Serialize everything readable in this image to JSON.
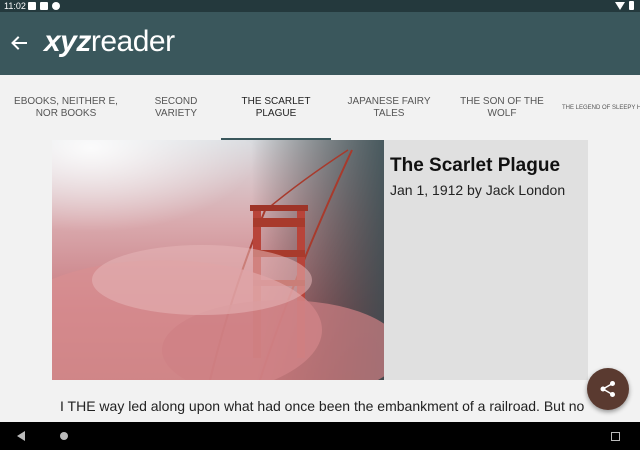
{
  "status_bar": {
    "time": "11:02"
  },
  "app_bar": {
    "logo_bold": "xyz",
    "logo_rest": "reader"
  },
  "tabs": [
    {
      "label": "EBOOKS, NEITHER E, NOR BOOKS"
    },
    {
      "label": "SECOND VARIETY"
    },
    {
      "label": "THE SCARLET PLAGUE"
    },
    {
      "label": "JAPANESE FAIRY TALES"
    },
    {
      "label": "THE SON OF THE WOLF"
    },
    {
      "label": "THE LEGEND OF SLEEPY HO"
    }
  ],
  "active_tab": 2,
  "article": {
    "title": "The Scarlet Plague",
    "byline": "Jan 1, 1912 by Jack London",
    "body_start": "I THE way led along upon what had once been the embankment of a railroad. But no"
  },
  "colors": {
    "toolbar": "#3a575c",
    "status_bar": "#24393d",
    "fab": "#5a3a30",
    "meta_panel": "#e0e0e0"
  },
  "icons": {
    "back": "arrow-left-icon",
    "share": "share-icon"
  }
}
